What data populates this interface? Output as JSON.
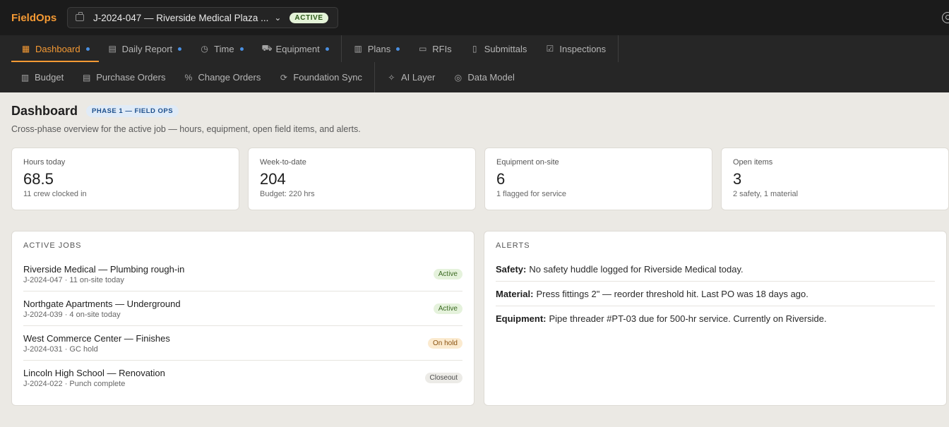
{
  "app": {
    "logo": "FieldOps"
  },
  "job_selector": {
    "text": "J-2024-047 — Riverside Medical Plaza ...",
    "status": "ACTIVE"
  },
  "nav_primary": [
    {
      "label": "Dashboard",
      "icon": "dashboard-icon",
      "glyph": "▦",
      "dot": true,
      "active": true
    },
    {
      "label": "Daily Report",
      "icon": "clipboard-icon",
      "glyph": "▤",
      "dot": true
    },
    {
      "label": "Time",
      "icon": "clock-icon",
      "glyph": "◷",
      "dot": true
    },
    {
      "label": "Equipment",
      "icon": "truck-icon",
      "glyph": "⛟",
      "dot": true
    },
    {
      "sep": true
    },
    {
      "label": "Plans",
      "icon": "map-icon",
      "glyph": "▥",
      "dot": true
    },
    {
      "label": "RFIs",
      "icon": "message-icon",
      "glyph": "▭"
    },
    {
      "label": "Submittals",
      "icon": "document-icon",
      "glyph": "▯"
    },
    {
      "label": "Inspections",
      "icon": "checklist-icon",
      "glyph": "☑"
    },
    {
      "sep": true
    }
  ],
  "nav_secondary": [
    {
      "label": "Budget",
      "icon": "bar-chart-icon",
      "glyph": "▥"
    },
    {
      "label": "Purchase Orders",
      "icon": "receipt-icon",
      "glyph": "▤"
    },
    {
      "label": "Change Orders",
      "icon": "percent-icon",
      "glyph": "%"
    },
    {
      "label": "Foundation Sync",
      "icon": "refresh-icon",
      "glyph": "⟳"
    },
    {
      "sep": true
    },
    {
      "label": "AI Layer",
      "icon": "sparkles-icon",
      "glyph": "✧"
    },
    {
      "label": "Data Model",
      "icon": "database-icon",
      "glyph": "◎"
    }
  ],
  "page": {
    "title": "Dashboard",
    "phase": "PHASE 1 — FIELD OPS",
    "subtitle": "Cross-phase overview for the active job — hours, equipment, open field items, and alerts."
  },
  "stats": [
    {
      "label": "Hours today",
      "value": "68.5",
      "sub": "11 crew clocked in"
    },
    {
      "label": "Week-to-date",
      "value": "204",
      "sub": "Budget: 220 hrs"
    },
    {
      "label": "Equipment on-site",
      "value": "6",
      "sub": "1 flagged for service"
    },
    {
      "label": "Open items",
      "value": "3",
      "sub": "2 safety, 1 material"
    }
  ],
  "active_jobs": {
    "title": "ACTIVE JOBS",
    "rows": [
      {
        "name": "Riverside Medical — Plumbing rough-in",
        "meta": "J-2024-047 · 11 on-site today",
        "status": "Active",
        "kind": "st-active"
      },
      {
        "name": "Northgate Apartments — Underground",
        "meta": "J-2024-039 · 4 on-site today",
        "status": "Active",
        "kind": "st-active"
      },
      {
        "name": "West Commerce Center — Finishes",
        "meta": "J-2024-031 · GC hold",
        "status": "On hold",
        "kind": "st-onhold"
      },
      {
        "name": "Lincoln High School — Renovation",
        "meta": "J-2024-022 · Punch complete",
        "status": "Closeout",
        "kind": "st-closeout"
      }
    ]
  },
  "alerts": {
    "title": "ALERTS",
    "rows": [
      {
        "label": "Safety:",
        "text": "No safety huddle logged for Riverside Medical today."
      },
      {
        "label": "Material:",
        "text": "Press fittings 2\" — reorder threshold hit. Last PO was 18 days ago."
      },
      {
        "label": "Equipment:",
        "text": "Pipe threader #PT-03 due for 500-hr service. Currently on Riverside."
      }
    ]
  }
}
